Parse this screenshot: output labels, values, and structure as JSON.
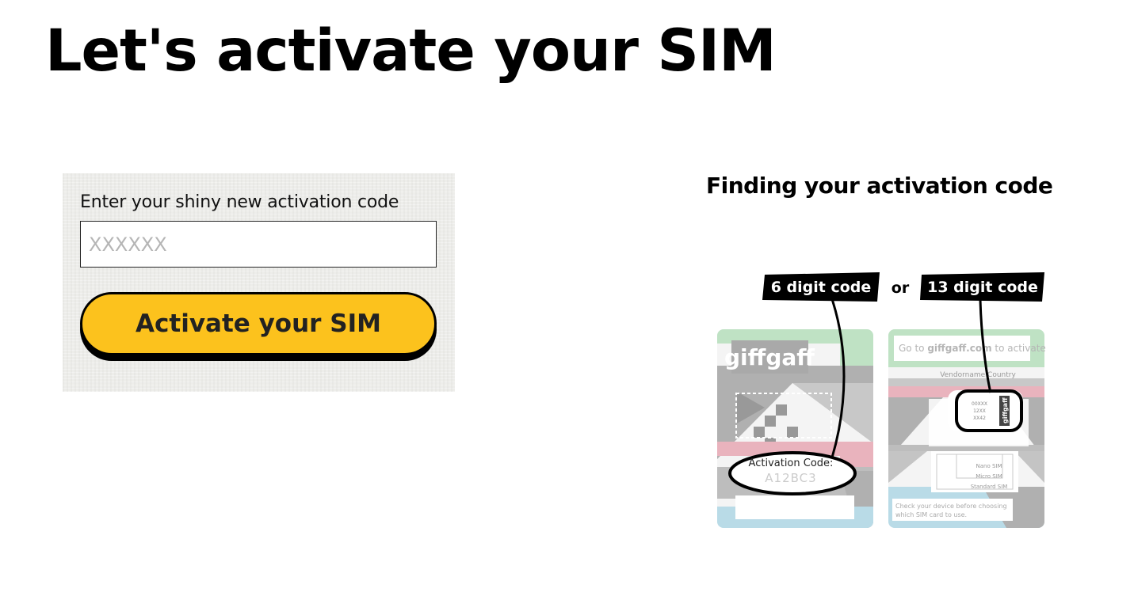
{
  "page": {
    "title": "Let's activate your SIM"
  },
  "activation_form": {
    "label": "Enter your shiny new activation code",
    "input_value": "",
    "input_placeholder": "XXXXXX",
    "button_label": "Activate your SIM"
  },
  "help": {
    "title": "Finding your activation code",
    "tag_6": "6 digit code",
    "separator": "or",
    "tag_13": "13 digit code",
    "card_left": {
      "brand": "giffgaff",
      "code_label": "Activation Code:",
      "code_value": "A12BC3"
    },
    "card_right": {
      "header_prefix": "Go to ",
      "header_link": "giffgaff.com",
      "header_suffix": " to activate",
      "sub_header": "Vendorname Country",
      "sim_code_lines": [
        "00XXX",
        "12XX",
        "XX42"
      ],
      "sim_brand": "giffgaff",
      "size_labels": [
        "Nano SIM",
        "Micro SIM",
        "Standard SIM"
      ],
      "footer_line1": "Check your device before choosing",
      "footer_line2": "which SIM card to use."
    }
  },
  "colors": {
    "button": "#fcc21d",
    "card_green": "#bfe2c4",
    "card_pink": "#e9b3bd",
    "card_blue": "#b9dbe7",
    "card_grey": "#b0b0b0"
  }
}
